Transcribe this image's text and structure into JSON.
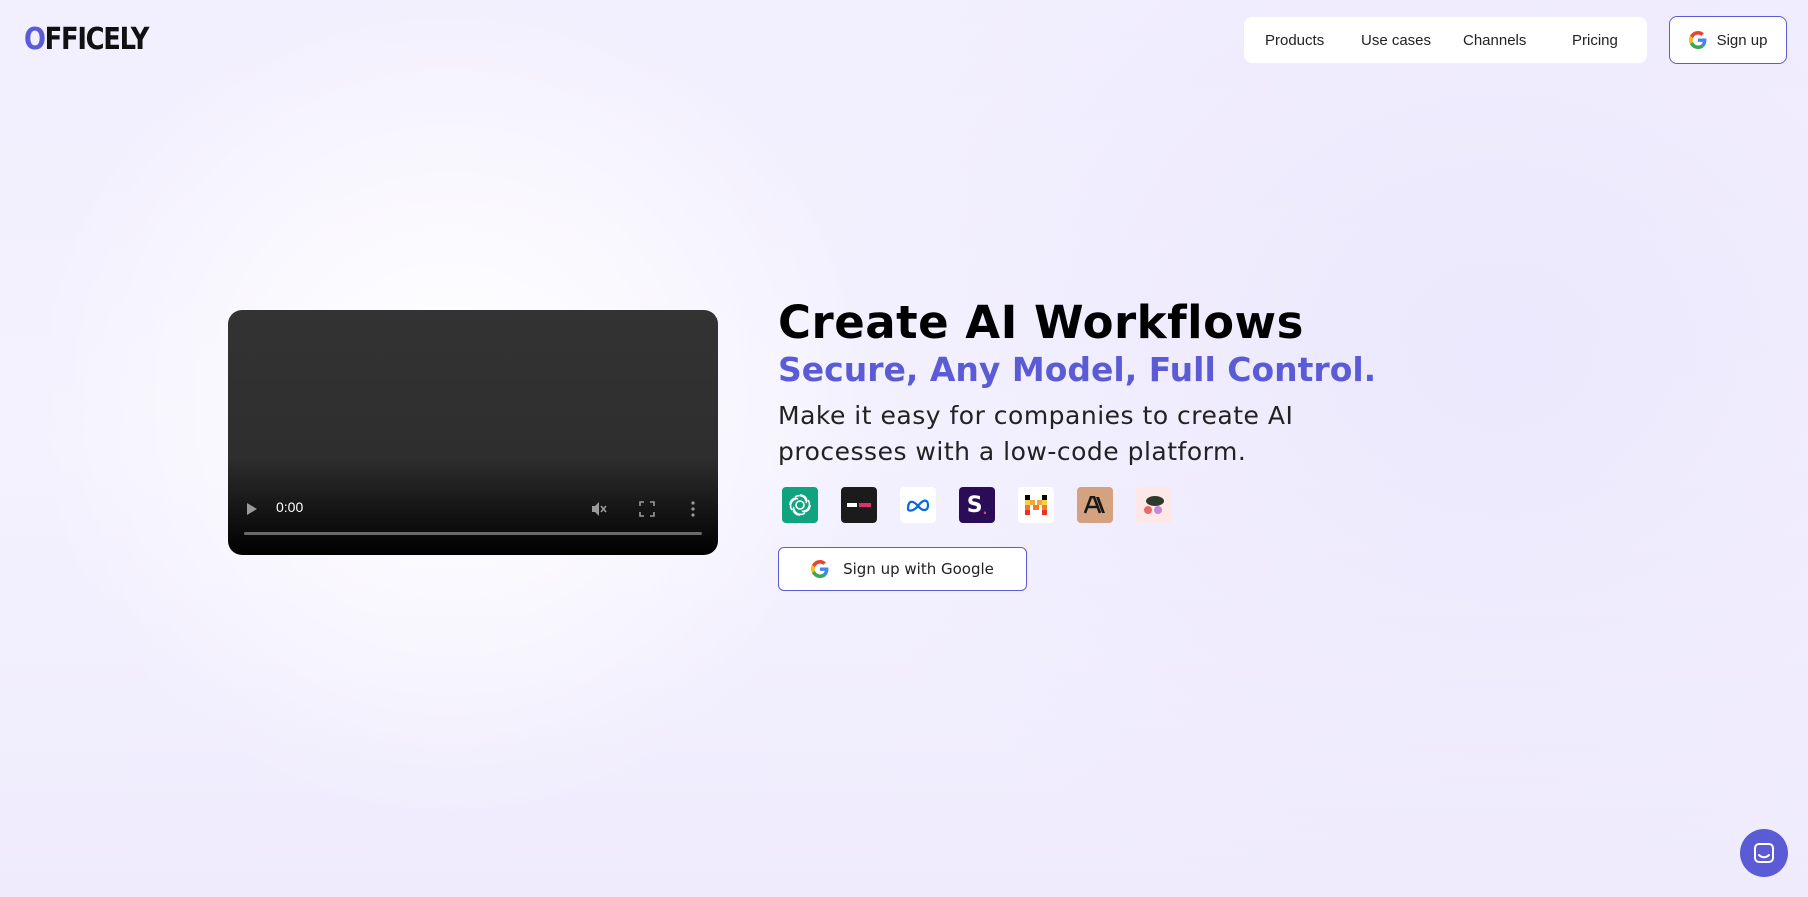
{
  "brand": {
    "logo_first": "O",
    "logo_rest": "FFICELY"
  },
  "nav": {
    "items": [
      {
        "label": "Products"
      },
      {
        "label": "Use cases"
      },
      {
        "label": "Channels"
      },
      {
        "label": "Pricing"
      }
    ],
    "signup_label": "Sign up"
  },
  "video": {
    "time": "0:00",
    "progress": 0
  },
  "hero": {
    "title": "Create AI Workflows",
    "subtitle": "Secure, Any Model, Full Control.",
    "description": "Make it easy for companies to create AI processes with a low-code platform.",
    "cta_label": "Sign up with Google"
  },
  "models": [
    {
      "icon": "openai-icon",
      "bg": "#10a37f"
    },
    {
      "icon": "aiml-icon",
      "bg": "#1b1b1b"
    },
    {
      "icon": "meta-icon",
      "bg": "#ffffff"
    },
    {
      "icon": "s-icon",
      "bg": "#2b0d57"
    },
    {
      "icon": "mistral-icon",
      "bg": "#ffffff"
    },
    {
      "icon": "anthropic-icon",
      "bg": "#d4a27f"
    },
    {
      "icon": "shapes-icon",
      "bg": "#fde8e8"
    }
  ],
  "colors": {
    "accent": "#5b5bd6"
  }
}
